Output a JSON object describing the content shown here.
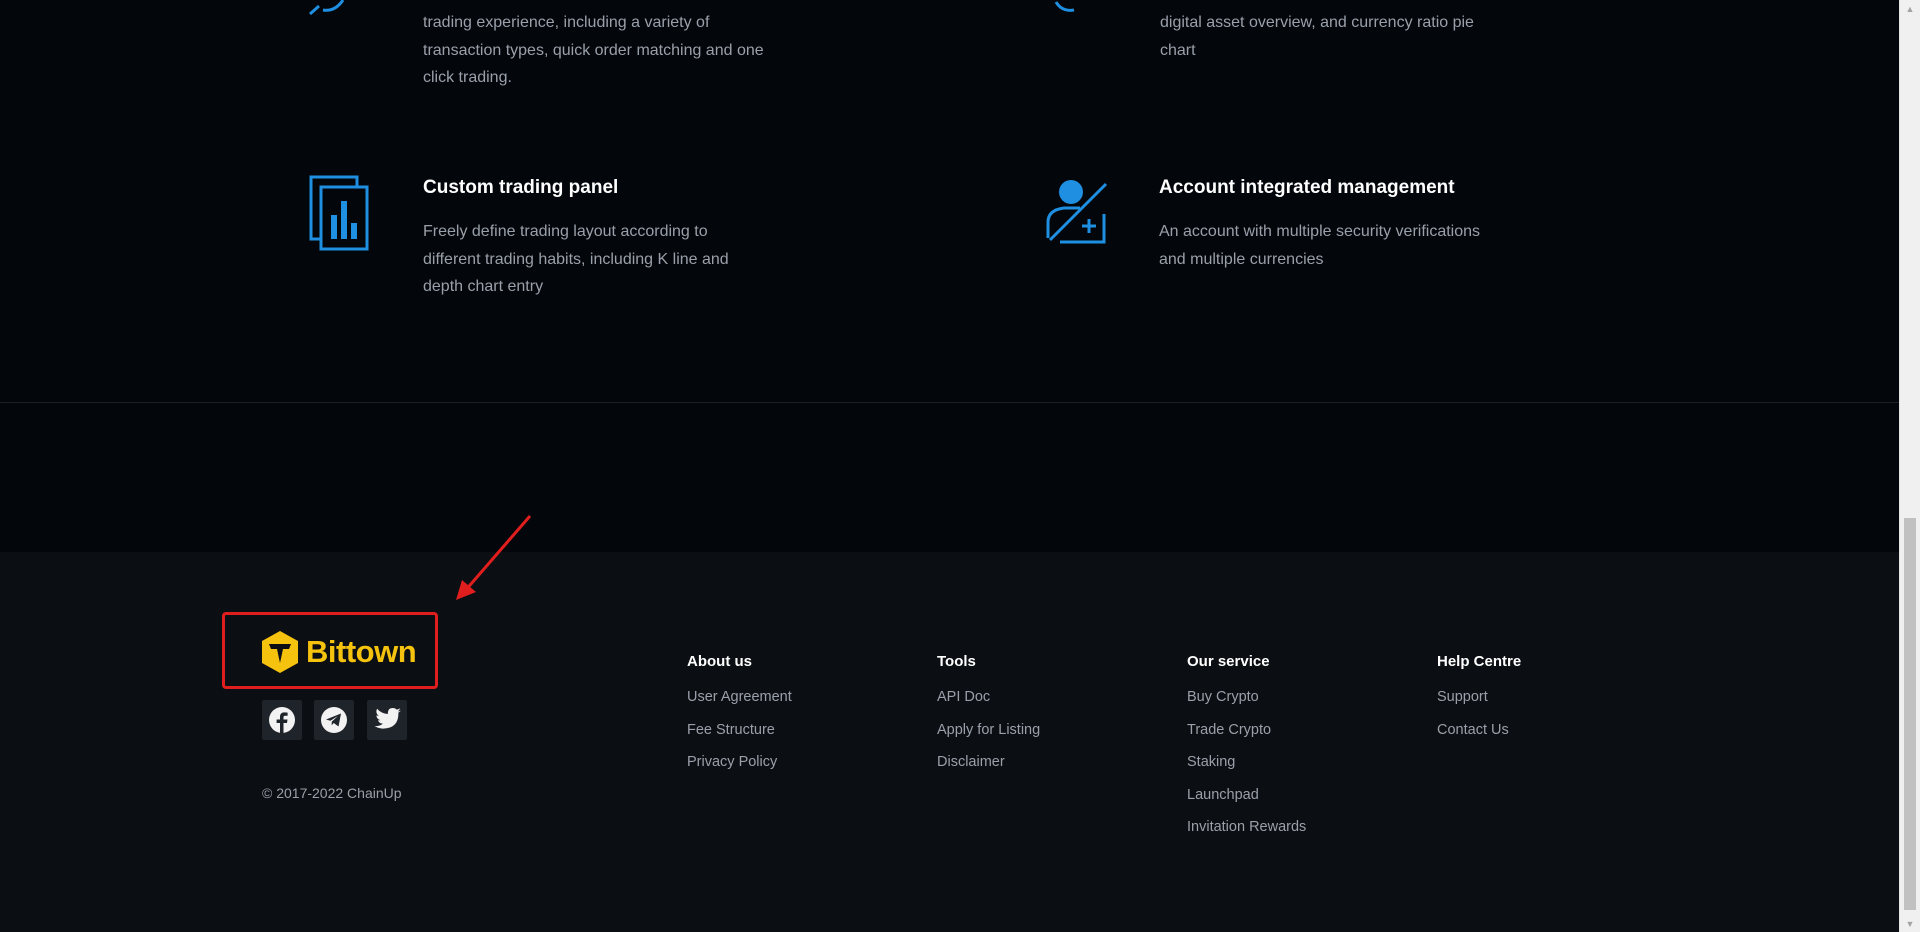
{
  "features": [
    {
      "title": "",
      "description_lines": [
        "trading experience, including a variety of",
        "transaction types, quick order matching and one",
        "click trading."
      ]
    },
    {
      "title": "",
      "description_lines": [
        "digital asset overview, and currency ratio pie",
        "chart"
      ]
    },
    {
      "title": "Custom trading panel",
      "description_lines": [
        "Freely define trading layout according to",
        "different trading habits, including K line and",
        "depth chart entry"
      ]
    },
    {
      "title": "Account integrated management",
      "description_lines": [
        "An account with multiple security verifications",
        "and multiple currencies"
      ]
    }
  ],
  "footer": {
    "brand": "Bittown",
    "social": [
      {
        "icon": "facebook-icon"
      },
      {
        "icon": "telegram-icon"
      },
      {
        "icon": "twitter-icon"
      }
    ],
    "copyright": "© 2017-2022 ChainUp",
    "columns": [
      {
        "heading": "About us",
        "links": [
          "User Agreement",
          "Fee Structure",
          "Privacy Policy"
        ]
      },
      {
        "heading": "Tools",
        "links": [
          "API Doc",
          "Apply for Listing",
          "Disclaimer"
        ]
      },
      {
        "heading": "Our service",
        "links": [
          "Buy Crypto",
          "Trade Crypto",
          "Staking",
          "Launchpad",
          "Invitation Rewards"
        ]
      },
      {
        "heading": "Help Centre",
        "links": [
          "Support",
          "Contact Us"
        ]
      }
    ]
  },
  "colors": {
    "page_bg": "#03060b",
    "footer_bg": "#0b0e12",
    "accent_icon": "#1e8fe1",
    "brand_yellow": "#f5c20d",
    "annotation_red": "#e01e1e"
  }
}
